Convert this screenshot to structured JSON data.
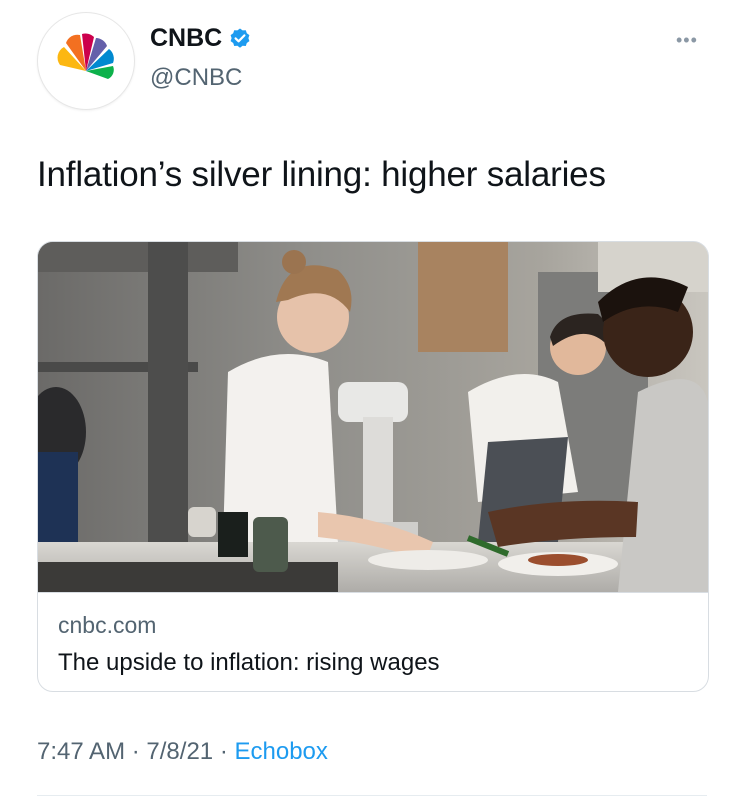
{
  "account": {
    "display_name": "CNBC",
    "handle": "@CNBC",
    "logo_text": "CNBC",
    "verified": true
  },
  "tweet": {
    "text": "Inflation’s silver lining: higher salaries"
  },
  "card": {
    "domain": "cnbc.com",
    "title": "The upside to inflation: rising wages",
    "image_icon": "kitchen-photo"
  },
  "meta": {
    "time": "7:47 AM",
    "separator": "·",
    "date": "7/8/21",
    "source": "Echobox"
  },
  "icons": {
    "more": "more-icon",
    "verified": "verified-badge-icon"
  },
  "colors": {
    "accent": "#1d9bf0",
    "text": "#0f1419",
    "secondary": "#536471"
  }
}
